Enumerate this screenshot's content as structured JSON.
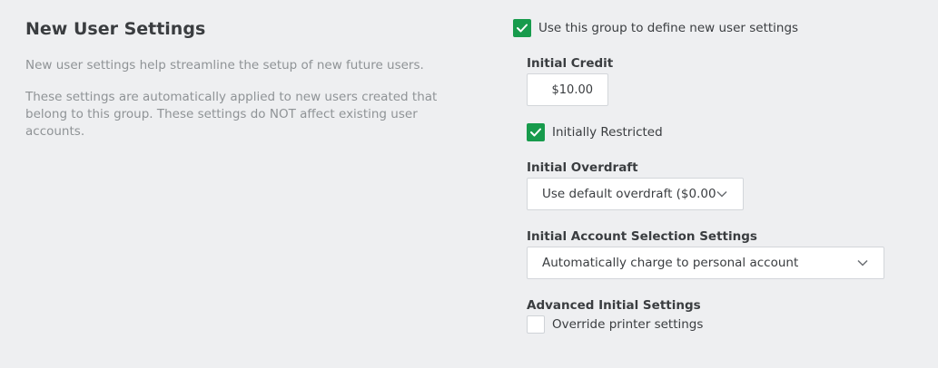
{
  "section": {
    "title": "New User Settings",
    "description_1": "New user settings help streamline the setup of new future users.",
    "description_2": "These settings are automatically applied to new users created that belong to this group. These settings do NOT affect existing user accounts."
  },
  "settings": {
    "use_group": {
      "label": "Use this group to define new user settings",
      "checked": true
    },
    "initial_credit": {
      "label": "Initial Credit",
      "value": "$10.00"
    },
    "initially_restricted": {
      "label": "Initially Restricted",
      "checked": true
    },
    "initial_overdraft": {
      "label": "Initial Overdraft",
      "selected": "Use default overdraft ($0.00)"
    },
    "account_selection": {
      "label": "Initial Account Selection Settings",
      "selected": "Automatically charge to personal account"
    },
    "advanced": {
      "label": "Advanced Initial Settings",
      "override_printer": {
        "label": "Override printer settings",
        "checked": false
      }
    }
  },
  "colors": {
    "background": "#eeeff1",
    "accent": "#179b4c",
    "muted_text": "#8f9396",
    "text": "#3a3d40"
  },
  "icons": {
    "check": "check-icon",
    "dropdown": "chevron-down-icon"
  }
}
